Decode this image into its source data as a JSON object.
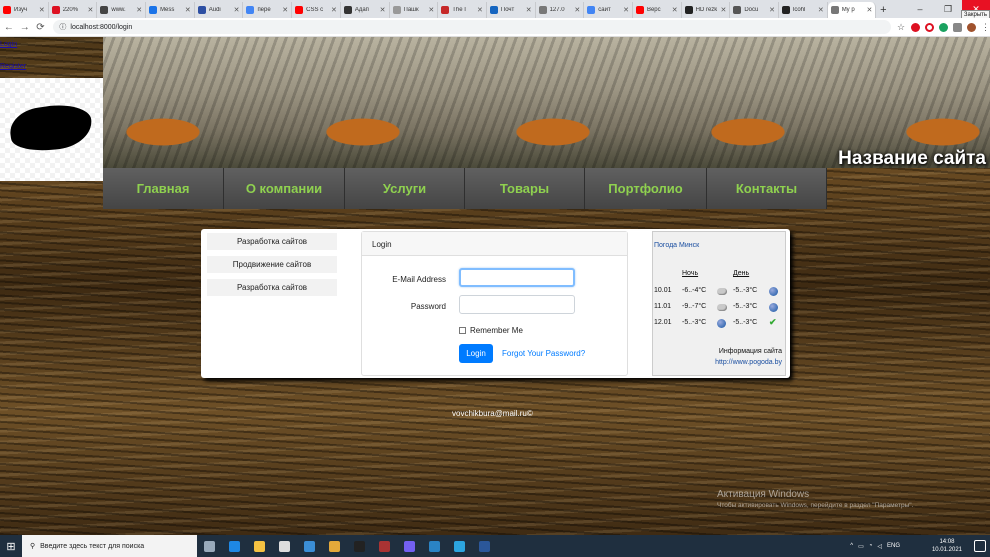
{
  "browser": {
    "tabs": [
      {
        "title": "Изуч",
        "color": "#ff0000"
      },
      {
        "title": "220%",
        "color": "#d12"
      },
      {
        "title": "www.",
        "color": "#444"
      },
      {
        "title": "Mess",
        "color": "#1a73e8"
      },
      {
        "title": "Audi",
        "color": "#2d4fa3"
      },
      {
        "title": "пере",
        "color": "#4285f4"
      },
      {
        "title": "CSS с",
        "color": "#ff0000"
      },
      {
        "title": "Адап",
        "color": "#333"
      },
      {
        "title": "Пашк",
        "color": "#999"
      },
      {
        "title": "The I",
        "color": "#c62828"
      },
      {
        "title": "Почт",
        "color": "#1565c0"
      },
      {
        "title": "127.0",
        "color": "#777"
      },
      {
        "title": "сайт",
        "color": "#4285f4"
      },
      {
        "title": "Верс",
        "color": "#ff0000"
      },
      {
        "title": "HD rezka",
        "color": "#222"
      },
      {
        "title": "Docu",
        "color": "#555"
      },
      {
        "title": "lcohl",
        "color": "#222"
      },
      {
        "title": "My p",
        "color": "#777",
        "active": true
      }
    ],
    "new_tab": "+",
    "window_controls": {
      "minimize": "–",
      "maximize": "❐",
      "close": "✕"
    },
    "close_tooltip": "Закрыть",
    "url": "localhost:8000/login",
    "nav": {
      "back": "←",
      "forward": "→",
      "reload": "⟳"
    }
  },
  "page": {
    "top_links": [
      "Login",
      "Register"
    ],
    "site_title": "Название сайта",
    "menu": [
      "Главная",
      "О компании",
      "Услуги",
      "Товары",
      "Портфолио",
      "Контакты"
    ],
    "sidebar": [
      "Разработка сайтов",
      "Продвижение сайтов",
      "Разработка сайтов"
    ],
    "login": {
      "header": "Login",
      "email_label": "E-Mail Address",
      "email_value": "",
      "password_label": "Password",
      "password_value": "",
      "remember_label": "Remember Me",
      "submit_label": "Login",
      "forgot_label": "Forgot Your Password?"
    },
    "weather": {
      "title": "Погода Минск",
      "night_header": "Ночь",
      "day_header": "День",
      "rows": [
        {
          "date": "10.01",
          "night": "-6..-4°C",
          "day": "-5..-3°C",
          "night_icon": "cloud-icon",
          "day_icon": "rain-icon"
        },
        {
          "date": "11.01",
          "night": "-9..-7°C",
          "day": "-5..-3°C",
          "night_icon": "cloud-icon",
          "day_icon": "rain-icon"
        },
        {
          "date": "12.01",
          "night": "-5..-3°C",
          "day": "-5..-3°C",
          "night_icon": "rain-icon",
          "day_icon": "sun-icon"
        }
      ],
      "info_label": "Информация сайта",
      "info_link": "http://www.pogoda.by"
    },
    "footer": "vovchikbura@mail.ru©",
    "activation": {
      "line1": "Активация Windows",
      "line2": "Чтобы активировать Windows, перейдите в раздел \"Параметры\"."
    }
  },
  "taskbar": {
    "search_placeholder": "Введите здесь текст для поиска",
    "apps": [
      {
        "name": "task-view-icon",
        "color": "#9ab"
      },
      {
        "name": "edge-icon",
        "color": "#1e88e5"
      },
      {
        "name": "file-explorer-icon",
        "color": "#f5c242"
      },
      {
        "name": "store-icon",
        "color": "#ddd"
      },
      {
        "name": "mail-icon",
        "color": "#3b8ed6"
      },
      {
        "name": "chrome-icon",
        "color": "#e4a93a"
      },
      {
        "name": "batman-icon",
        "color": "#222"
      },
      {
        "name": "media-icon",
        "color": "#a33"
      },
      {
        "name": "viber-icon",
        "color": "#7360f2"
      },
      {
        "name": "app-icon",
        "color": "#2a83c4"
      },
      {
        "name": "telegram-icon",
        "color": "#2ca5e0"
      },
      {
        "name": "word-icon",
        "color": "#2b579a"
      }
    ],
    "language": "ENG",
    "time": "14:08",
    "date": "10.01.2021"
  }
}
